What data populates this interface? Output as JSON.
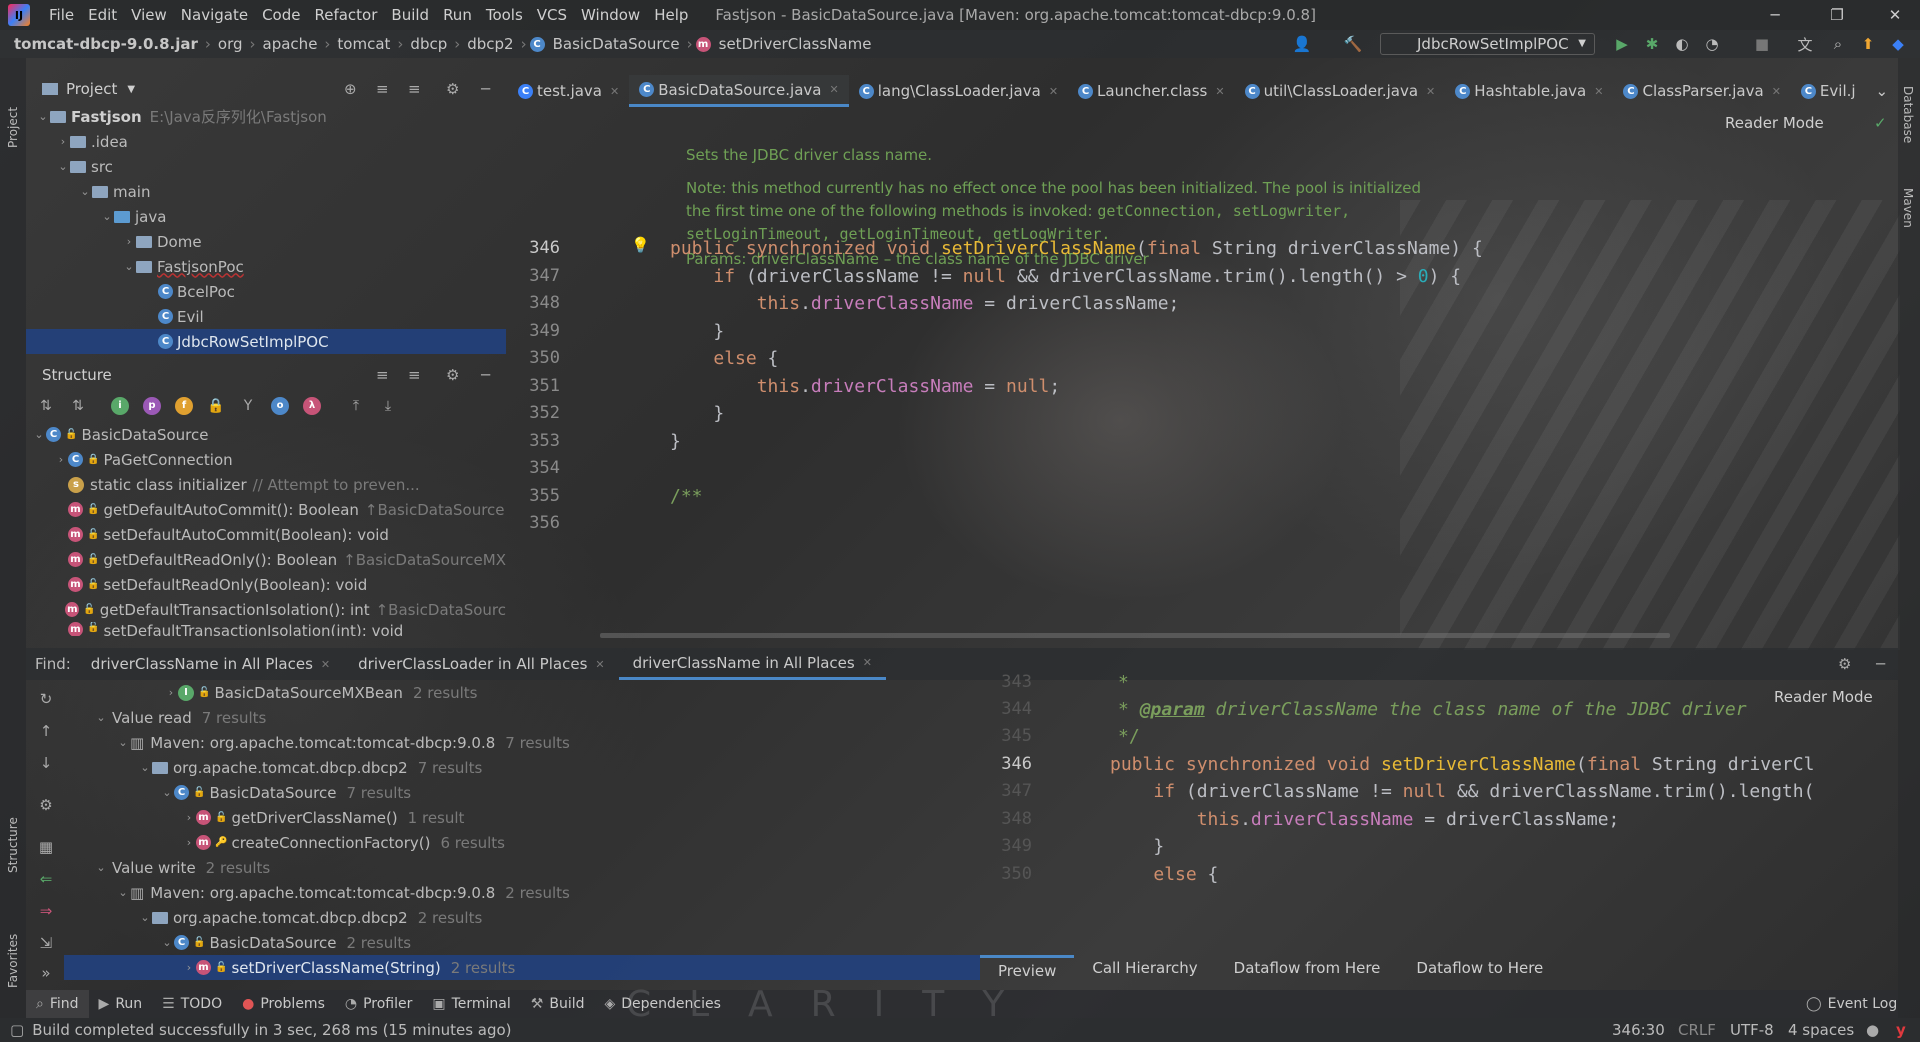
{
  "menu": [
    "File",
    "Edit",
    "View",
    "Navigate",
    "Code",
    "Refactor",
    "Build",
    "Run",
    "Tools",
    "VCS",
    "Window",
    "Help"
  ],
  "window_title": "Fastjson - BasicDataSource.java [Maven: org.apache.tomcat:tomcat-dbcp:9.0.8]",
  "breadcrumb": [
    "tomcat-dbcp-9.0.8.jar",
    "org",
    "apache",
    "tomcat",
    "dbcp",
    "dbcp2",
    "BasicDataSource",
    "setDriverClassName"
  ],
  "run_config": "JdbcRowSetImplPOC",
  "project_panel": {
    "title": "Project",
    "tree": [
      {
        "label": "Fastjson",
        "note": "E:\\Java反序列化\\Fastjson"
      },
      {
        "label": ".idea"
      },
      {
        "label": "src"
      },
      {
        "label": "main"
      },
      {
        "label": "java"
      },
      {
        "label": "Dome"
      },
      {
        "label": "FastjsonPoc"
      },
      {
        "label": "BcelPoc"
      },
      {
        "label": "Evil"
      },
      {
        "label": "JdbcRowSetImplPOC"
      }
    ]
  },
  "structure_panel": {
    "title": "Structure",
    "items": [
      {
        "label": "BasicDataSource",
        "note": ""
      },
      {
        "label": "PaGetConnection",
        "note": ""
      },
      {
        "label": "static class initializer",
        "note": "// Attempt to preven..."
      },
      {
        "label": "getDefaultAutoCommit(): Boolean",
        "note": "↑BasicDataSource"
      },
      {
        "label": "setDefaultAutoCommit(Boolean): void",
        "note": ""
      },
      {
        "label": "getDefaultReadOnly(): Boolean",
        "note": "↑BasicDataSourceMX"
      },
      {
        "label": "setDefaultReadOnly(Boolean): void",
        "note": ""
      },
      {
        "label": "getDefaultTransactionIsolation(): int",
        "note": "↑BasicDataSourc"
      },
      {
        "label": "setDefaultTransactionIsolation(int): void",
        "note": ""
      }
    ]
  },
  "editor_tabs": [
    "test.java",
    "BasicDataSource.java",
    "lang\\ClassLoader.java",
    "Launcher.class",
    "util\\ClassLoader.java",
    "Hashtable.java",
    "ClassParser.java",
    "Evil.j"
  ],
  "reader_mode": "Reader Mode",
  "doc": {
    "line1": "Sets the JDBC driver class name.",
    "line2a": "Note: this method currently has no effect once the pool has been initialized. The pool is initialized",
    "line2b": "the first time one of the following methods is invoked:",
    "line2c": "getConnection, setLogwriter,",
    "line2d": "setLoginTimeout, getLoginTimeout, getLogWriter.",
    "line3": "Params: driverClassName – the class name of the JDBC driver"
  },
  "editor_lines": [
    "346",
    "347",
    "348",
    "349",
    "350",
    "351",
    "352",
    "353",
    "354",
    "355",
    "356"
  ],
  "find": {
    "label": "Find:",
    "tabs": [
      "driverClassName in All Places",
      "driverClassLoader in All Places",
      "driverClassName in All Places"
    ],
    "results": [
      {
        "label": "BasicDataSourceMXBean",
        "count": "2 results"
      },
      {
        "label": "Value read",
        "count": "7 results"
      },
      {
        "label": "Maven: org.apache.tomcat:tomcat-dbcp:9.0.8",
        "count": "7 results"
      },
      {
        "label": "org.apache.tomcat.dbcp.dbcp2",
        "count": "7 results"
      },
      {
        "label": "BasicDataSource",
        "count": "7 results"
      },
      {
        "label": "getDriverClassName()",
        "count": "1 result"
      },
      {
        "label": "createConnectionFactory()",
        "count": "6 results"
      },
      {
        "label": "Value write",
        "count": "2 results"
      },
      {
        "label": "Maven: org.apache.tomcat:tomcat-dbcp:9.0.8",
        "count": "2 results"
      },
      {
        "label": "org.apache.tomcat.dbcp.dbcp2",
        "count": "2 results"
      },
      {
        "label": "BasicDataSource",
        "count": "2 results"
      },
      {
        "label": "setDriverClassName(String)",
        "count": "2 results"
      }
    ]
  },
  "preview_lines": [
    "343",
    "344",
    "345",
    "346",
    "347",
    "348",
    "349",
    "350"
  ],
  "preview_tabs": [
    "Preview",
    "Call Hierarchy",
    "Dataflow from Here",
    "Dataflow to Here"
  ],
  "tool_windows": [
    "Find",
    "Run",
    "TODO",
    "Problems",
    "Profiler",
    "Terminal",
    "Build",
    "Dependencies"
  ],
  "event_log": "Event Log",
  "status": {
    "message": "Build completed successfully in 3 sec, 268 ms (15 minutes ago)",
    "position": "346:30",
    "line_sep": "CRLF",
    "encoding": "UTF-8",
    "indent": "4 spaces"
  },
  "side_labels": {
    "project": "Project",
    "structure": "Structure",
    "favorites": "Favorites",
    "database": "Database",
    "maven": "Maven"
  },
  "watermark": "CLARITY"
}
